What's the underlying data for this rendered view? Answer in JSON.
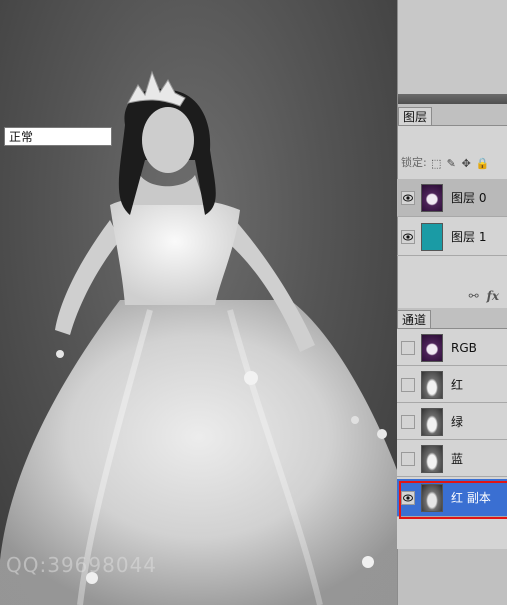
{
  "canvas": {
    "watermark": "QQ:39698044"
  },
  "layers_panel": {
    "tab_label": "图层",
    "blend_mode": "正常",
    "lock_label": "锁定:",
    "layers": [
      {
        "name": "图层 0",
        "visible": true,
        "thumb": "purple-dress",
        "selected": true
      },
      {
        "name": "图层 1",
        "visible": true,
        "thumb": "teal-fill",
        "selected": false
      }
    ],
    "footer_icons": [
      "link-icon",
      "fx-icon"
    ],
    "footer_fx": "fx"
  },
  "channels_panel": {
    "tab_label": "通道",
    "channels": [
      {
        "name": "RGB",
        "visible": false,
        "thumb": "color",
        "selected": false
      },
      {
        "name": "红",
        "visible": false,
        "thumb": "gray",
        "selected": false
      },
      {
        "name": "绿",
        "visible": false,
        "thumb": "gray",
        "selected": false
      },
      {
        "name": "蓝",
        "visible": false,
        "thumb": "gray",
        "selected": false
      },
      {
        "name": "红 副本",
        "visible": true,
        "thumb": "bw",
        "selected": true
      }
    ]
  },
  "colors": {
    "selection": "#3a6fd2",
    "highlight": "#e01515",
    "teal_layer": "#1a9ba5"
  }
}
